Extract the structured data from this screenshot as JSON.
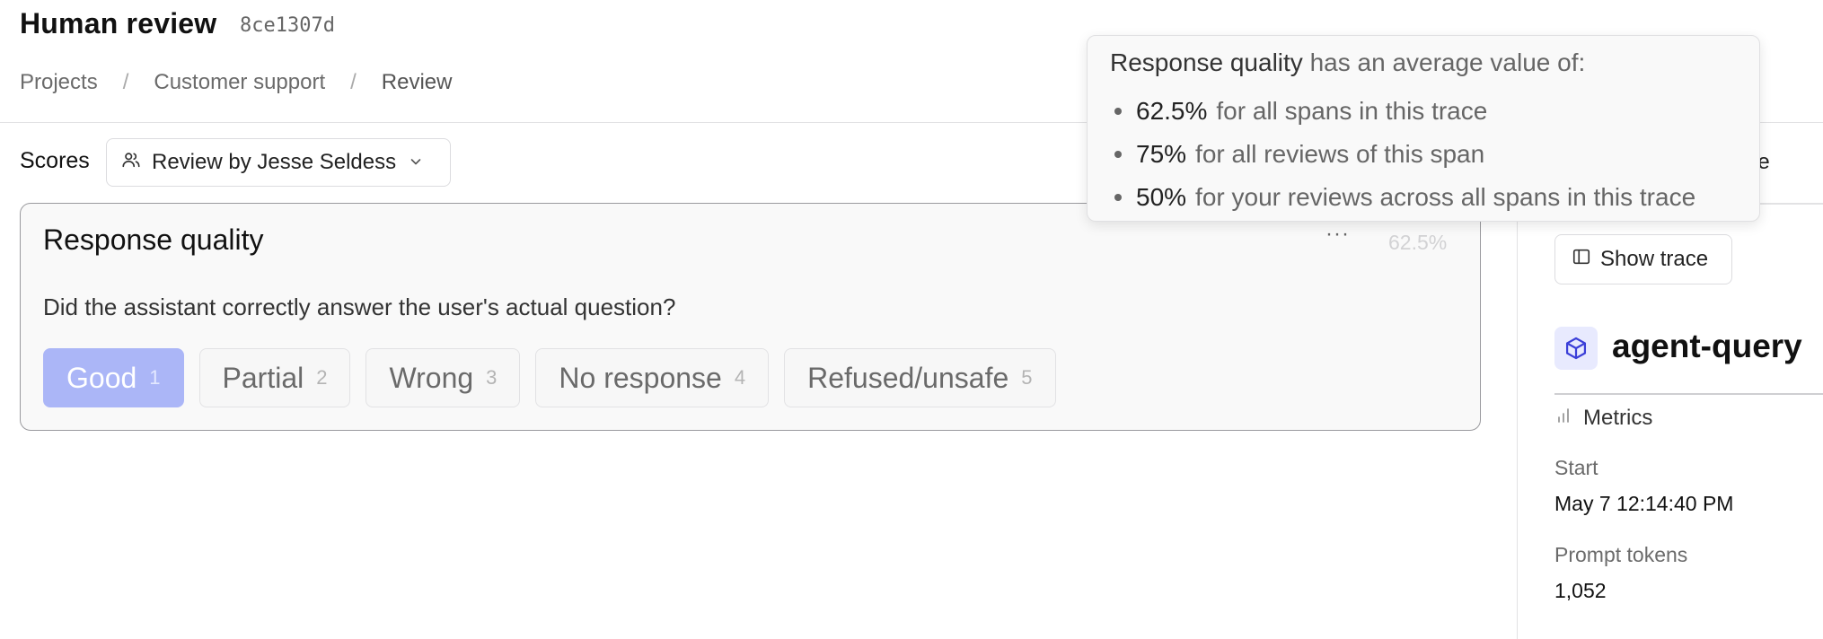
{
  "header": {
    "title": "Human review",
    "hash": "8ce1307d",
    "breadcrumbs": [
      {
        "label": "Projects"
      },
      {
        "label": "Customer support"
      },
      {
        "label": "Review"
      }
    ]
  },
  "scores": {
    "label": "Scores",
    "reviewer_selector": "Review by Jesse Seldess"
  },
  "score_card": {
    "title": "Response quality",
    "more_icon": "ellipsis-icon",
    "average": "62.5%",
    "question": "Did the assistant correctly answer the user's actual question?",
    "options": [
      {
        "label": "Good",
        "key": "1",
        "selected": true
      },
      {
        "label": "Partial",
        "key": "2"
      },
      {
        "label": "Wrong",
        "key": "3"
      },
      {
        "label": "No response",
        "key": "4"
      },
      {
        "label": "Refused/unsafe",
        "key": "5"
      }
    ]
  },
  "tooltip": {
    "metric_name": "Response quality",
    "intro": " has an average value of:",
    "items": [
      {
        "value": "62.5%",
        "text": "for all spans in this trace"
      },
      {
        "value": "75%",
        "text": "for all reviews of this span"
      },
      {
        "value": "50%",
        "text": "for your reviews across all spans in this trace"
      }
    ]
  },
  "right_panel": {
    "timeline_fragment": "eline",
    "show_trace": "Show trace",
    "span_name": "agent-query",
    "metrics_label": "Metrics",
    "fields": [
      {
        "label": "Start",
        "value": "May 7 12:14:40 PM"
      },
      {
        "label": "Prompt tokens",
        "value": "1,052"
      }
    ]
  },
  "colors": {
    "accent": "#abb6f7",
    "span_icon": "#3b3fd8",
    "border": "#e2e2e4"
  }
}
